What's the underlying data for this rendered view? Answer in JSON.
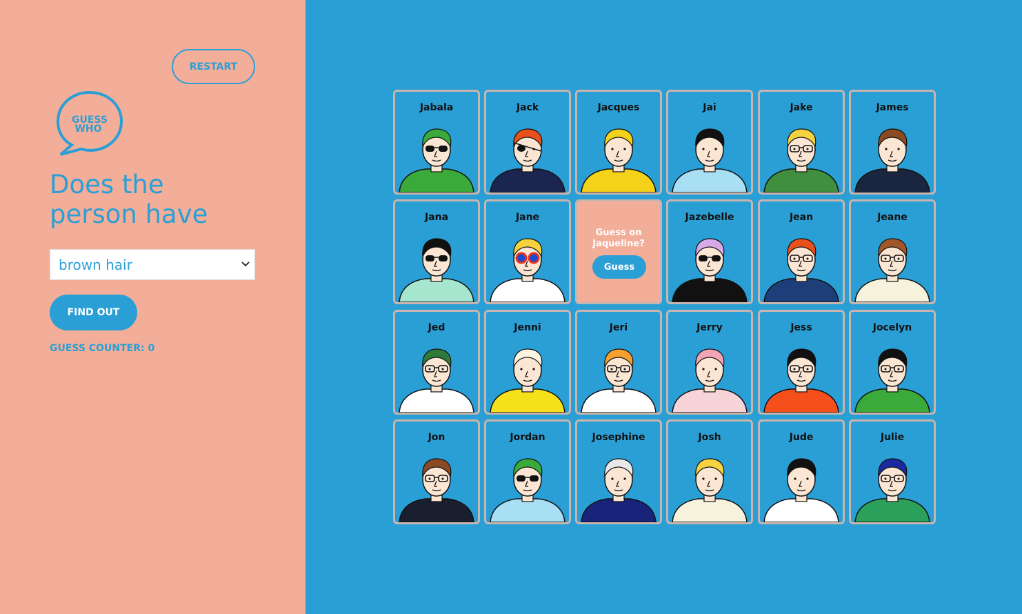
{
  "controls": {
    "restart_label": "RESTART",
    "logo_text_line1": "GUESS",
    "logo_text_line2": "WHO",
    "question_line1": "Does the",
    "question_line2": "person have",
    "select_value": "brown hair",
    "findout_label": "FIND OUT",
    "counter_text": "GUESS COUNTER: 0"
  },
  "colors": {
    "sidebar": "#f2ae99",
    "board": "#2a9fd6",
    "accent": "#2a9fd6"
  },
  "cards": [
    {
      "name": "Jabala",
      "shirt": "#3aaa3a",
      "hair": "#3aaa3a",
      "glasses": "sunglasses"
    },
    {
      "name": "Jack",
      "shirt": "#1a2550",
      "hair": "#e8501c",
      "glasses": "eyepatch"
    },
    {
      "name": "Jacques",
      "shirt": "#f5d21a",
      "hair": "#f5d21a",
      "glasses": "none"
    },
    {
      "name": "Jai",
      "shirt": "#a9dff5",
      "hair": "#111111",
      "glasses": "none"
    },
    {
      "name": "Jake",
      "shirt": "#3f8f3f",
      "hair": "#f5d240",
      "glasses": "glasses"
    },
    {
      "name": "James",
      "shirt": "#1a2540",
      "hair": "#8a4a24",
      "glasses": "none"
    },
    {
      "name": "Jana",
      "shirt": "#a6e6cf",
      "hair": "#111111",
      "glasses": "sunglasses"
    },
    {
      "name": "Jane",
      "shirt": "#ffffff",
      "hair": "#f5d240",
      "glasses": "goggles"
    },
    {
      "name": "Jazebelle",
      "shirt": "#111111",
      "hair": "#d7a9e6",
      "glasses": "sunglasses"
    },
    {
      "name": "Jean",
      "shirt": "#1e3e7a",
      "hair": "#e8501c",
      "glasses": "glasses"
    },
    {
      "name": "Jeane",
      "shirt": "#f7f2dc",
      "hair": "#a0582a",
      "glasses": "glasses"
    },
    {
      "name": "Jed",
      "shirt": "#ffffff",
      "hair": "#2f7a3a",
      "glasses": "glasses"
    },
    {
      "name": "Jenni",
      "shirt": "#f5e01a",
      "hair": "#faf5e0",
      "glasses": "none"
    },
    {
      "name": "Jeri",
      "shirt": "#ffffff",
      "hair": "#f5a030",
      "glasses": "glasses"
    },
    {
      "name": "Jerry",
      "shirt": "#f7d4d8",
      "hair": "#f4a5b5",
      "glasses": "none"
    },
    {
      "name": "Jess",
      "shirt": "#f5501c",
      "hair": "#111111",
      "glasses": "glasses"
    },
    {
      "name": "Jocelyn",
      "shirt": "#3aaa3a",
      "hair": "#111111",
      "glasses": "glasses"
    },
    {
      "name": "Jon",
      "shirt": "#1a1f30",
      "hair": "#8a4a24",
      "glasses": "glasses"
    },
    {
      "name": "Jordan",
      "shirt": "#a9dff5",
      "hair": "#3aaa3a",
      "glasses": "sunglasses"
    },
    {
      "name": "Josephine",
      "shirt": "#1a237a",
      "hair": "#e8e8e8",
      "glasses": "none"
    },
    {
      "name": "Josh",
      "shirt": "#f7f2dc",
      "hair": "#f5d240",
      "glasses": "none"
    },
    {
      "name": "Jude",
      "shirt": "#ffffff",
      "hair": "#111111",
      "glasses": "none"
    },
    {
      "name": "Julie",
      "shirt": "#2aa05a",
      "hair": "#1a2aa0",
      "glasses": "glasses"
    }
  ],
  "flipped_card": {
    "guess_text": "Guess on Jaqueline?",
    "guess_button": "Guess"
  }
}
